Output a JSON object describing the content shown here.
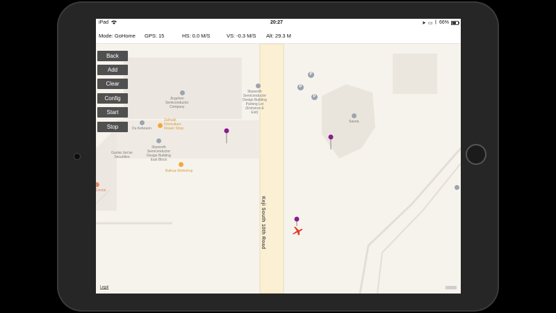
{
  "statusbar": {
    "carrier": "iPad",
    "time": "20:27",
    "battery": "66%"
  },
  "telemetry": {
    "mode": "Mode:  GoHome",
    "gps": "GPS:   15",
    "hs": "HS:   0.0 M/S",
    "vs": "VS:   -0.3 M/S",
    "alt": "Alt:   29.3 M"
  },
  "controls": {
    "back": "Back",
    "add": "Add",
    "clear": "Clear",
    "config": "Config",
    "start": "Start",
    "stop": "Stop"
  },
  "map": {
    "road_name": "Keji South 10th Road",
    "poi": {
      "jingchen": [
        "Jingchen",
        "Semiconductor",
        "Company"
      ],
      "skyworth_parking": [
        "Skyworth",
        "Semiconductor",
        "Design Building",
        "Parking Lot",
        "(Entrance &",
        "Exit)"
      ],
      "du_kebouon": [
        "Du Kebouon"
      ],
      "zaihuali": [
        "Zaihuali",
        "Floriculture",
        "Flower Shop"
      ],
      "guotai": [
        "Guotai Jun'an",
        "Securities"
      ],
      "skyworth_east": [
        "Skyworth",
        "Semiconductor",
        "Design Building",
        "East Block"
      ],
      "baihua": [
        "Baihua Workshop"
      ],
      "sauna": [
        "Sauna"
      ],
      "dental": [
        "Dental"
      ]
    },
    "legal": "Legal"
  },
  "colors": {
    "control_bg": "#505050",
    "pin_purple": "#8a1e8c",
    "aircraft_red": "#e23b2b",
    "road_fill": "#fbf0d4",
    "poi_orange": "#f2a93b"
  }
}
